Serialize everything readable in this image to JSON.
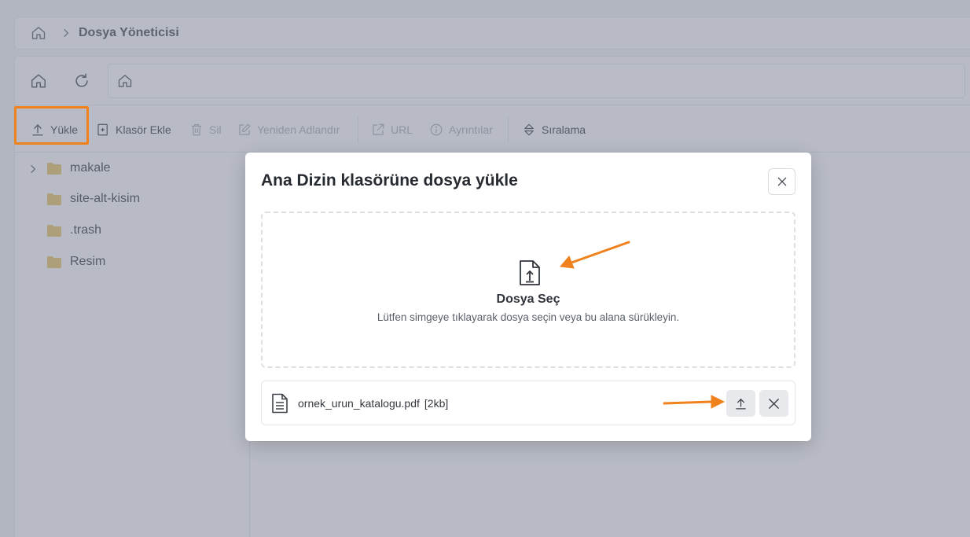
{
  "breadcrumb": {
    "home_icon": "home-icon",
    "separator_icon": "chevron-right-icon",
    "title": "Dosya Yöneticisi"
  },
  "nav": {
    "home_icon": "home-icon",
    "refresh_icon": "refresh-icon",
    "path_home_icon": "home-icon"
  },
  "toolbar": {
    "upload": "Yükle",
    "add_folder": "Klasör Ekle",
    "delete": "Sil",
    "rename": "Yeniden Adlandır",
    "url": "URL",
    "details": "Ayrıntılar",
    "sort": "Sıralama",
    "highlight_color": "#f0821e"
  },
  "tree": {
    "items": [
      {
        "label": "makale",
        "expandable": true
      },
      {
        "label": "site-alt-kisim",
        "expandable": false
      },
      {
        "label": ".trash",
        "expandable": false
      },
      {
        "label": "Resim",
        "expandable": false
      }
    ],
    "folder_color": "#e6c36e"
  },
  "modal": {
    "title": "Ana Dizin klasörüne dosya yükle",
    "close_icon": "close-icon",
    "dropzone": {
      "icon": "file-upload-icon",
      "title": "Dosya Seç",
      "hint": "Lütfen simgeye tıklayarak dosya seçin veya bu alana sürükleyin."
    },
    "file": {
      "icon": "document-icon",
      "name": "ornek_urun_katalogu.pdf",
      "size": "[2kb]",
      "upload_icon": "upload-icon",
      "remove_icon": "close-icon"
    }
  },
  "annotation_color": "#f0821e"
}
